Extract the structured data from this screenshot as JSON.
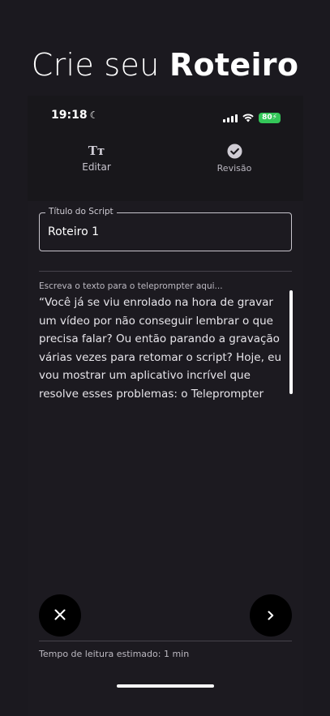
{
  "headline": {
    "light": "Crie seu ",
    "bold": "Roteiro"
  },
  "status_bar": {
    "time": "19:18",
    "moon": "☾",
    "battery": "80"
  },
  "tabs": [
    {
      "label": "Editar",
      "icon": "text-format-icon",
      "glyph": "Tт"
    },
    {
      "label": "Revisão",
      "icon": "check-circle-icon"
    }
  ],
  "title_field": {
    "legend": "Título do Script",
    "value": "Roteiro 1"
  },
  "script": {
    "placeholder": "Escreva o texto para o teleprompter aqui...",
    "text": "“Você já se viu enrolado na hora de gravar um vídeo por não conseguir lembrar o que precisa falar? Ou então parando a gravação várias vezes para retomar o script? Hoje, eu vou mostrar um aplicativo incrível que resolve esses problemas: o Teleprompter"
  },
  "actions": {
    "close_icon": "close-icon",
    "next_icon": "chevron-right-icon"
  },
  "footer": {
    "reading_time": "Tempo de leitura estimado: 1 min"
  },
  "colors": {
    "background": "#1b191f",
    "battery": "#34c759",
    "button": "#000000"
  }
}
